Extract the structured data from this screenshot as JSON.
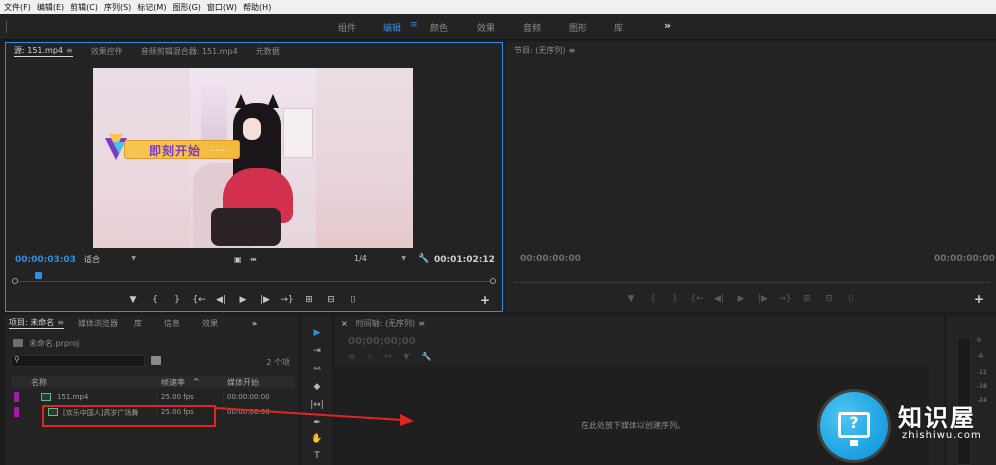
{
  "menubar": {
    "items": [
      "文件(F)",
      "编辑(E)",
      "剪辑(C)",
      "序列(S)",
      "标记(M)",
      "图形(G)",
      "窗口(W)",
      "帮助(H)"
    ]
  },
  "workspaces": {
    "tabs": [
      "组件",
      "编辑",
      "颜色",
      "效果",
      "音频",
      "图形",
      "库"
    ],
    "active": "编辑",
    "menu_glyph": "≡",
    "more_glyph": "»"
  },
  "source_monitor": {
    "tabs": [
      "源: 151.mp4",
      "效果控件",
      "音频剪辑混合器: 151.mp4",
      "元数据"
    ],
    "tab_menu_glyph": "≡",
    "video_title_text": "即刻开始",
    "video_title_dots": "......",
    "current_timecode": "00:00:03:03",
    "fit": "适合",
    "resolution": "1/4",
    "duration": "00:01:02:12",
    "transport": [
      "▼",
      "{",
      "}",
      "{←",
      "◀|",
      "▶",
      "|▶",
      "→}",
      "⊞",
      "⊟",
      "⌷"
    ],
    "add_label": "+"
  },
  "program_monitor": {
    "tab": "节目: (无序列)",
    "tab_menu_glyph": "≡",
    "timecode_left": "00:00:00:00",
    "timecode_right": "00:00:00:00",
    "transport": [
      "▼",
      "{",
      "}",
      "{←",
      "◀|",
      "▶",
      "|▶",
      "→}",
      "⊞",
      "⊟",
      "⌷"
    ],
    "add_label": "+"
  },
  "project_panel": {
    "tabs": [
      "项目: 未命名",
      "媒体浏览器",
      "库",
      "信息",
      "效果"
    ],
    "more_glyph": "»",
    "project_file": "未命名.prproj",
    "item_count": "2 个项",
    "columns": [
      "名称",
      "帧速率",
      "媒体开始"
    ],
    "sort_glyph": "^",
    "assets": [
      {
        "name": "151.mp4",
        "fps": "25.00 fps",
        "start": "00:00:00:00"
      },
      {
        "name": "[欢乐中国人]高岁广场舞",
        "fps": "25.00 fps",
        "start": "00:00:00:00"
      }
    ]
  },
  "tools": {
    "items": [
      "selection-tool",
      "track-select-tool",
      "ripple-edit-tool",
      "razor-tool",
      "slip-tool",
      "pen-tool",
      "hand-tool",
      "type-tool"
    ],
    "glyphs": [
      "▶",
      "⇥",
      "⇿",
      "◆",
      "|↔|",
      "✒",
      "✋",
      "T"
    ]
  },
  "timeline": {
    "tab": "时间轴: (无序列)",
    "tab_menu_glyph": "≡",
    "timecode": "00;00;00;00",
    "hint": "在此处放下媒体以创建序列。"
  },
  "audio_meter": {
    "scale": [
      "0",
      "-6",
      "-12",
      "-18",
      "-24"
    ]
  },
  "watermark": {
    "title": "知识屋",
    "url": "zhishiwu.com"
  },
  "colors": {
    "accent": "#2e8ee0",
    "highlight": "#e12424",
    "label_violet": "#a21ba8"
  }
}
